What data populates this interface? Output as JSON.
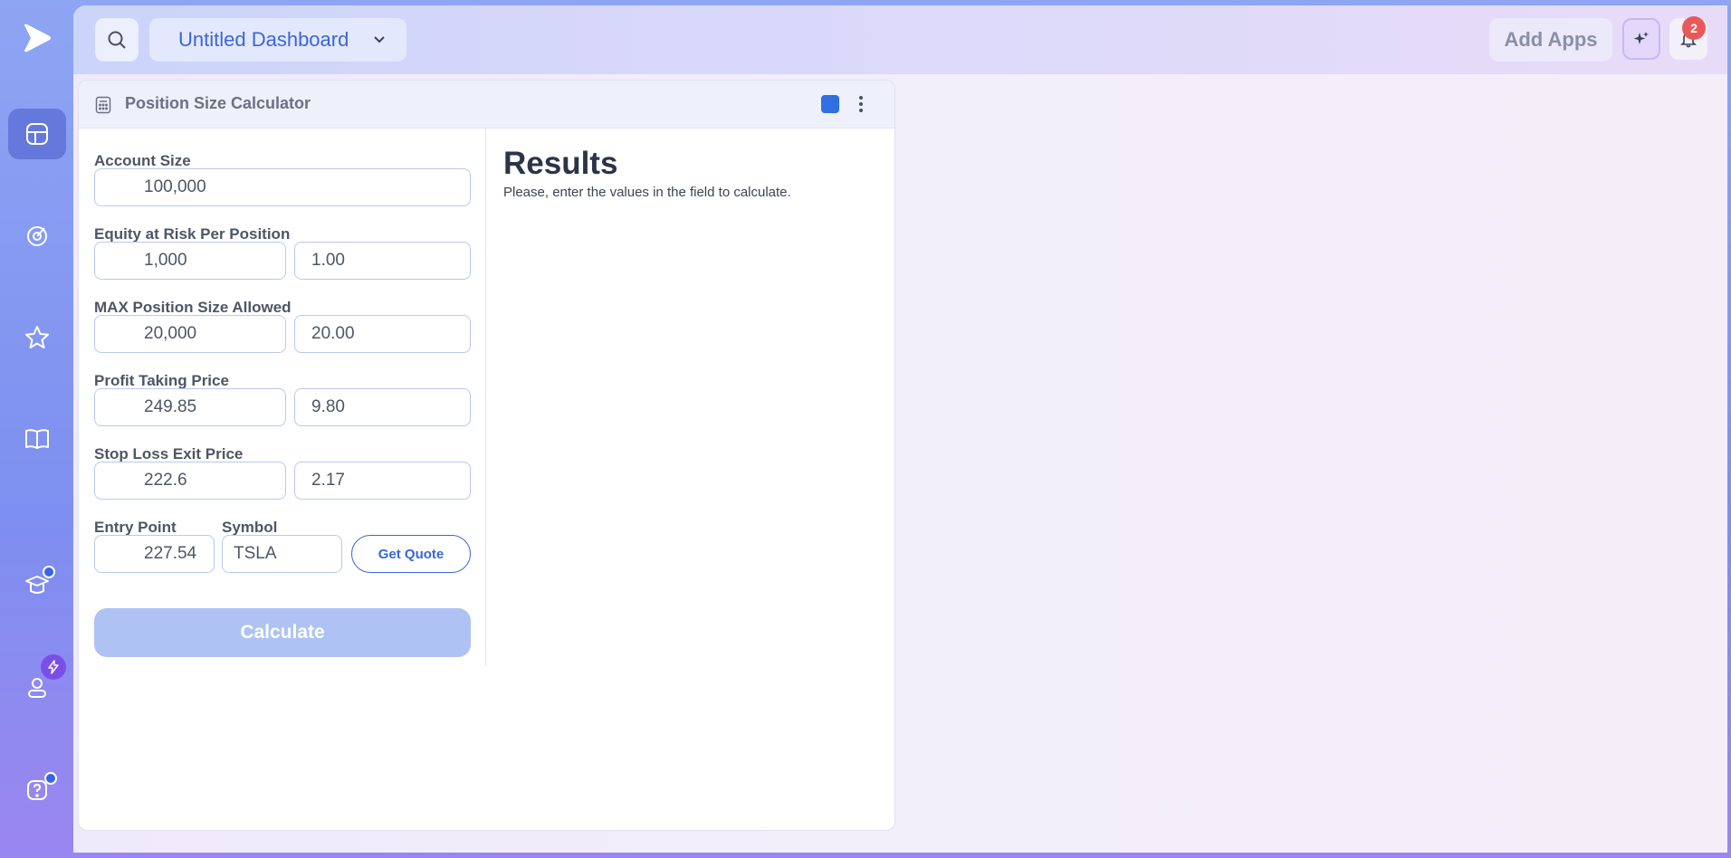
{
  "header": {
    "dashboard_title": "Untitled Dashboard",
    "add_apps_label": "Add Apps",
    "notification_count": "2"
  },
  "sidebar": {
    "items": [
      {
        "icon": "dashboard-icon",
        "active": true
      },
      {
        "icon": "target-icon",
        "active": false
      },
      {
        "icon": "star-icon",
        "active": false
      },
      {
        "icon": "book-icon",
        "active": false
      },
      {
        "icon": "graduation-cap-icon",
        "active": false
      },
      {
        "icon": "user-icon",
        "active": false
      },
      {
        "icon": "help-icon",
        "active": false
      }
    ]
  },
  "widget": {
    "title": "Position Size Calculator",
    "color": "#2f6fe0",
    "fields": {
      "account_size": {
        "label": "Account Size",
        "value": "100,000"
      },
      "equity_at_risk": {
        "label": "Equity at Risk Per Position",
        "value": "1,000",
        "percent": "1.00"
      },
      "max_position": {
        "label": "MAX Position Size Allowed",
        "value": "20,000",
        "percent": "20.00"
      },
      "profit_taking": {
        "label": "Profit Taking Price",
        "value": "249.85",
        "percent": "9.80"
      },
      "stop_loss": {
        "label": "Stop Loss Exit Price",
        "value": "222.6",
        "percent": "2.17"
      },
      "entry_point": {
        "label": "Entry Point",
        "value": "227.54"
      },
      "symbol": {
        "label": "Symbol",
        "value": "TSLA"
      }
    },
    "get_quote_label": "Get Quote",
    "calculate_label": "Calculate",
    "results": {
      "title": "Results",
      "message": "Please, enter the values in the field to calculate."
    }
  },
  "colors": {
    "accent": "#3a66d8",
    "badge": "#e85a5a"
  }
}
